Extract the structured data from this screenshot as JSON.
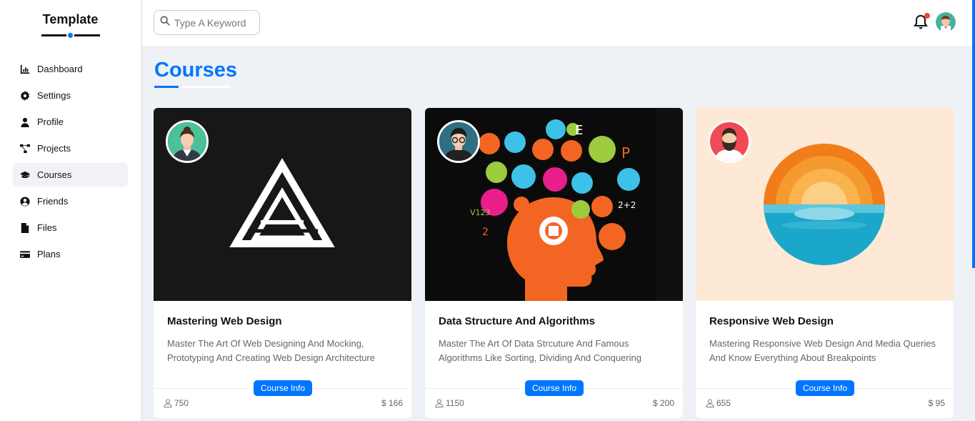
{
  "brand": "Template",
  "nav": [
    {
      "label": "Dashboard",
      "icon": "chart-icon"
    },
    {
      "label": "Settings",
      "icon": "gear-icon"
    },
    {
      "label": "Profile",
      "icon": "user-icon"
    },
    {
      "label": "Projects",
      "icon": "diagram-icon"
    },
    {
      "label": "Courses",
      "icon": "graduation-cap-icon"
    },
    {
      "label": "Friends",
      "icon": "user-circle-icon"
    },
    {
      "label": "Files",
      "icon": "file-icon"
    },
    {
      "label": "Plans",
      "icon": "credit-card-icon"
    }
  ],
  "active_nav": "Courses",
  "search": {
    "placeholder": "Type A Keyword"
  },
  "page_title": "Courses",
  "courses": [
    {
      "title": "Mastering Web Design",
      "description": "Master The Art Of Web Designing And Mocking, Prototyping And Creating Web Design Architecture",
      "button": "Course Info",
      "students": "750",
      "price": "$ 166"
    },
    {
      "title": "Data Structure And Algorithms",
      "description": "Master The Art Of Data Strcuture And Famous Algorithms Like Sorting, Dividing And Conquering",
      "button": "Course Info",
      "students": "1150",
      "price": "$ 200"
    },
    {
      "title": "Responsive Web Design",
      "description": "Mastering Responsive Web Design And Media Queries And Know Everything About Breakpoints",
      "button": "Course Info",
      "students": "655",
      "price": "$ 95"
    }
  ],
  "colors": {
    "accent": "#0075ff",
    "notification": "#f44336"
  }
}
